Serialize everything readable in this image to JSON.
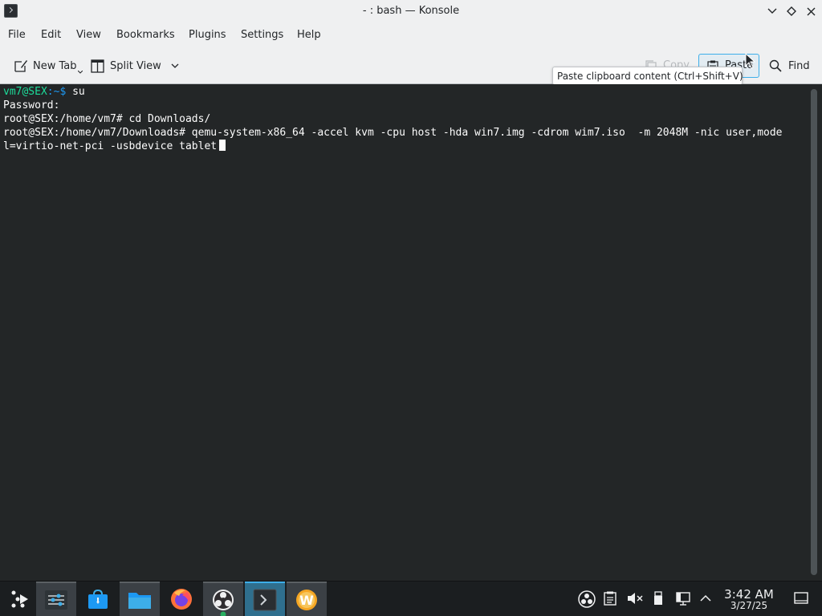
{
  "window": {
    "title": "- : bash — Konsole"
  },
  "menubar": {
    "items": [
      "File",
      "Edit",
      "View",
      "Bookmarks",
      "Plugins",
      "Settings",
      "Help"
    ]
  },
  "toolbar": {
    "new_tab_label": "New Tab",
    "split_view_label": "Split View",
    "copy_label": "Copy",
    "paste_label": "Paste",
    "find_label": "Find",
    "tooltip": "Paste clipboard content (Ctrl+Shift+V)"
  },
  "terminal": {
    "lines": [
      {
        "prompt_user": "vm7@SEX",
        "prompt_path": ":~$",
        "command": " su"
      },
      {
        "text": "Password:"
      },
      {
        "text": "root@SEX:/home/vm7# cd Downloads/"
      },
      {
        "text": "root@SEX:/home/vm7/Downloads# qemu-system-x86_64 -accel kvm -cpu host -hda win7.img -cdrom wim7.iso  -m 2048M -nic user,mode"
      },
      {
        "text": "l=virtio-net-pci -usbdevice tablet"
      }
    ]
  },
  "taskbar": {
    "apps": [
      "application-launcher-icon",
      "system-settings-icon",
      "discover-store-icon",
      "dolphin-files-icon",
      "firefox-icon",
      "obs-studio-icon",
      "konsole-icon",
      "wps-writer-icon"
    ],
    "tray_icons": [
      "obs-tray-icon",
      "clipboard-icon",
      "volume-muted-icon",
      "usb-device-icon",
      "network-icon",
      "tray-expand-icon"
    ],
    "clock_time": "3:42 AM",
    "clock_date": "3/27/25"
  },
  "colors": {
    "terminal_bg": "#232627",
    "prompt_user": "#1cdc9a",
    "prompt_path": "#1d99f3",
    "accent": "#3daee9",
    "chrome_bg": "#eff0f1"
  }
}
